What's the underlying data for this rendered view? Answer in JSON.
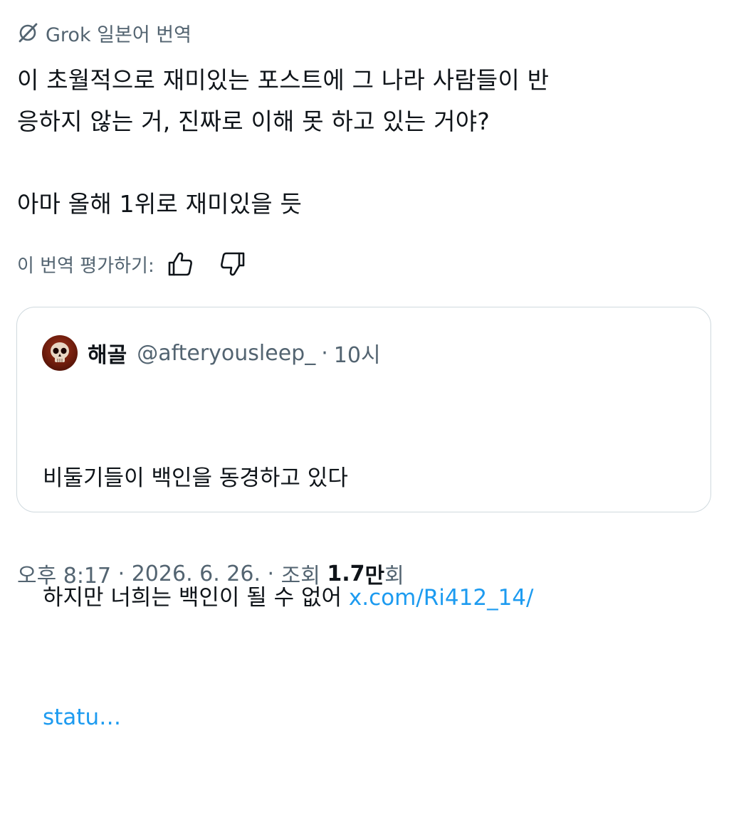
{
  "translation": {
    "icon": "grok-icon",
    "label": "Grok 일본어 번역"
  },
  "post": {
    "line1": "이 초월적으로 재미있는 포스트에 그 나라 사람들이 반",
    "line2": "응하지 않는 거, 진짜로 이해 못 하고 있는 거야?",
    "line3": "",
    "line4": "아마 올해 1위로 재미있을 듯"
  },
  "rating": {
    "label": "이 번역 평가하기:",
    "up_icon": "thumbs-up-icon",
    "down_icon": "thumbs-down-icon"
  },
  "quote": {
    "avatar_icon": "skull-avatar",
    "name": "해골",
    "handle": "@afteryousleep_",
    "separator": "·",
    "time": "10시",
    "line1": "비둘기들이 백인을 동경하고 있다",
    "line2": "하지만 너희는 백인이 될 수 없어 ",
    "link_part1": "x.com/Ri412_14/",
    "link_part2": "statu…"
  },
  "meta": {
    "time": "오후 8:17",
    "sep1": " · ",
    "date": "2026. 6. 26.",
    "sep2": " · ",
    "views_label": "조회 ",
    "views_num": "1.7",
    "views_unit_bold": "만",
    "views_suffix": "회"
  },
  "colors": {
    "text": "#0f1419",
    "secondary": "#536471",
    "link": "#1d9bf0",
    "border": "#cfd9de"
  }
}
